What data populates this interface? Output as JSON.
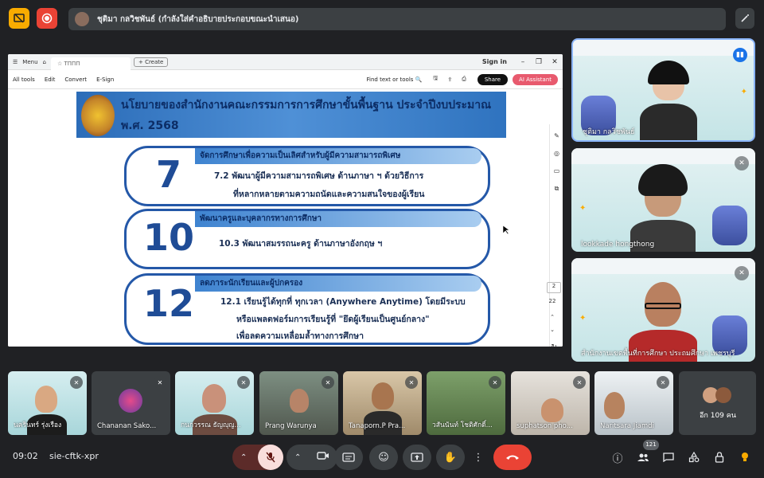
{
  "topbar": {
    "presenter_text": "ชุติมา กลวิชพันธ์ (กำลังใส่คำอธิบายประกอบขณะนำเสนอ)"
  },
  "share": {
    "chrome": {
      "menu_label": "Menu",
      "tab_label": "ΤΠΠΠ",
      "create_label": "Create",
      "signin_label": "Sign in"
    },
    "toolbar": {
      "items": [
        "All tools",
        "Edit",
        "Convert",
        "E-Sign"
      ],
      "find_label": "Find text or tools",
      "share_label": "Share",
      "ai_label": "AI Assistant"
    },
    "slide": {
      "title_line1": "นโยบายของสำนักงานคณะกรรมการการศึกษาขั้นพื้นฐาน ประจำปีงบประมาณ",
      "title_line2": "พ.ศ. 2568",
      "blocks": [
        {
          "number": "7",
          "heading": "จัดการศึกษาเพื่อความเป็นเลิศสำหรับผู้มีความสามารถพิเศษ",
          "lines": [
            "7.2 พัฒนาผู้มีความสามารถพิเศษ  ด้านภาษา ฯ ด้วยวิธีการ",
            "ที่หลากหลายตามความถนัดและความสนใจของผู้เรียน"
          ]
        },
        {
          "number": "10",
          "heading": "พัฒนาครูและบุคลากรทางการศึกษา",
          "lines": [
            "10.3 พัฒนาสมรรถนะครู ด้านภาษาอังกฤษ ฯ"
          ]
        },
        {
          "number": "12",
          "heading": "ลดภาระนักเรียนและผู้ปกครอง",
          "lines": [
            "12.1 เรียนรู้ได้ทุกที่ ทุกเวลา (Anywhere Anytime) โดยมีระบบ",
            "หรือแพลตฟอร์มการเรียนรู้ที่ \"ยึดผู้เรียนเป็นศูนย์กลาง\"",
            "เพื่อลดความเหลื่อมล้ำทางการศึกษา"
          ]
        }
      ]
    },
    "page_current": "2",
    "page_total": "22"
  },
  "right_tiles": [
    {
      "name": "ชุติมา กลวิชพันธ์",
      "bg": "#dff0f1"
    },
    {
      "name": "lookkade hongthong",
      "bg": "#dff0f1"
    },
    {
      "name": "สำนักงานเขตพื้นที่การศึกษา ประถมศึกษา เพชรบุรี",
      "bg": "#dff0f1"
    }
  ],
  "bottom_tiles": [
    {
      "name": "นครินทร์ รุ่งเรือง"
    },
    {
      "name": "Chananan Sako..."
    },
    {
      "name": "กนกวรรณ ธัญญุญ..."
    },
    {
      "name": "Prang Warunya"
    },
    {
      "name": "Tanaporn.P Pra..."
    },
    {
      "name": "วสันนันท์ โชติศักดิ์..."
    },
    {
      "name": "suphatson pho..."
    },
    {
      "name": "Naritsara Jiamdi"
    }
  ],
  "more_participants": "อีก 109 คน",
  "bottombar": {
    "time": "09:02",
    "meeting_code": "sie-cftk-xpr",
    "participant_count": "121"
  },
  "colors": {
    "end_call": "#ea4335",
    "mic_off": "#f9dedc",
    "accent_yellow": "#f9ab00",
    "accent_red": "#ea4335"
  }
}
